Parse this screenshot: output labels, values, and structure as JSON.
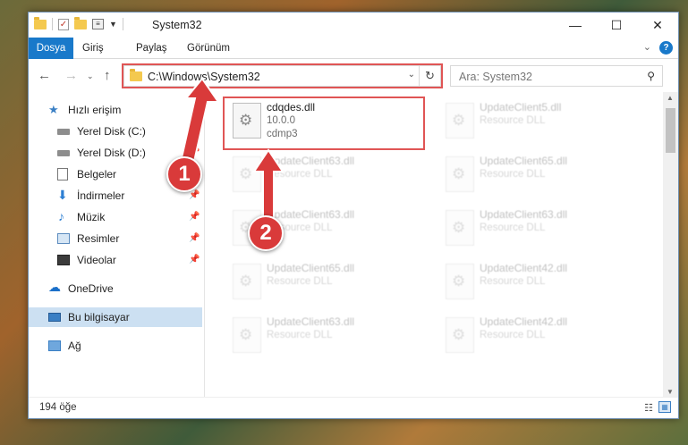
{
  "window": {
    "title": "System32",
    "controls": {
      "minimize": "—",
      "maximize": "☐",
      "close": "✕"
    }
  },
  "ribbon": {
    "tabs": [
      "Dosya",
      "Giriş",
      "Paylaş",
      "Görünüm"
    ],
    "help": "?"
  },
  "address": {
    "path": "C:\\Windows\\System32",
    "search_placeholder": "Ara: System32"
  },
  "sidebar": {
    "items": [
      {
        "label": "Hızlı erişim",
        "icon": "star-icon",
        "pinned": false
      },
      {
        "label": "Yerel Disk (C:)",
        "icon": "drive-icon",
        "pinned": true
      },
      {
        "label": "Yerel Disk (D:)",
        "icon": "drive-icon",
        "pinned": true
      },
      {
        "label": "Belgeler",
        "icon": "documents-icon",
        "pinned": true
      },
      {
        "label": "İndirmeler",
        "icon": "download-icon",
        "pinned": true
      },
      {
        "label": "Müzik",
        "icon": "music-icon",
        "pinned": true
      },
      {
        "label": "Resimler",
        "icon": "pictures-icon",
        "pinned": true
      },
      {
        "label": "Videolar",
        "icon": "videos-icon",
        "pinned": true
      },
      {
        "label": "OneDrive",
        "icon": "cloud-icon",
        "pinned": false
      },
      {
        "label": "Bu bilgisayar",
        "icon": "computer-icon",
        "pinned": false,
        "selected": true
      },
      {
        "label": "Ağ",
        "icon": "network-icon",
        "pinned": false
      }
    ]
  },
  "files": [
    {
      "name": "cdqdes.dll",
      "line2": "10.0.0",
      "line3": "cdmp3",
      "highlighted": true
    },
    {
      "name": "UpdateClient5.dll",
      "line2": "Resource DLL",
      "line3": ""
    },
    {
      "name": "UpdateClient63.dll",
      "line2": "Resource DLL",
      "line3": ""
    },
    {
      "name": "UpdateClient65.dll",
      "line2": "Resource DLL",
      "line3": ""
    },
    {
      "name": "UpdateClient63.dll",
      "line2": "Resource DLL",
      "line3": ""
    },
    {
      "name": "UpdateClient63.dll",
      "line2": "Resource DLL",
      "line3": ""
    },
    {
      "name": "UpdateClient65.dll",
      "line2": "Resource DLL",
      "line3": ""
    },
    {
      "name": "UpdateClient42.dll",
      "line2": "Resource DLL",
      "line3": ""
    },
    {
      "name": "UpdateClient63.dll",
      "line2": "Resource DLL",
      "line3": ""
    },
    {
      "name": "UpdateClient42.dll",
      "line2": "Resource DLL",
      "line3": ""
    }
  ],
  "status": {
    "count": "194 öğe"
  },
  "annotations": {
    "badge1": "1",
    "badge2": "2"
  },
  "colors": {
    "accent": "#1979ca",
    "highlight": "#e05555",
    "selected": "#cce0f2"
  }
}
